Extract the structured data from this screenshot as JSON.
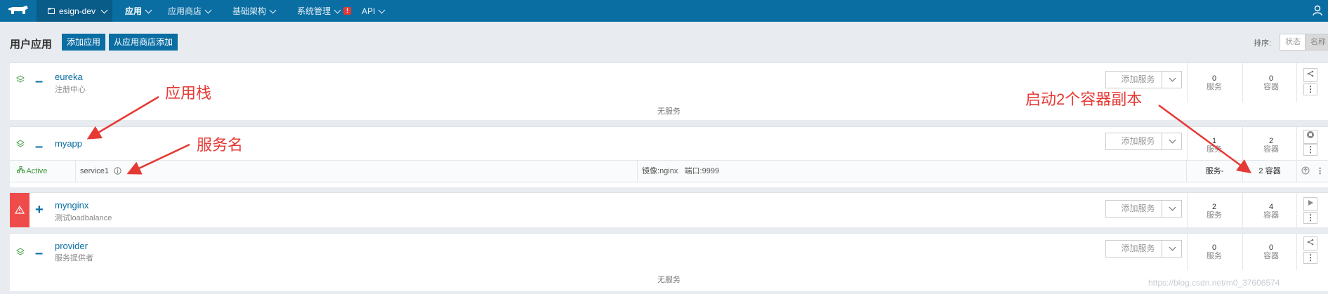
{
  "topbar": {
    "env_label": "esign-dev",
    "nav": [
      {
        "label": "应用",
        "active": true
      },
      {
        "label": "应用商店"
      },
      {
        "label": "基础架构"
      },
      {
        "label": "系统管理",
        "alert": "!"
      },
      {
        "label": "API"
      }
    ]
  },
  "toolbar": {
    "title": "用户应用",
    "add_app": "添加应用",
    "add_from_store": "从应用商店添加",
    "sort_label": "排序:",
    "sort_options": [
      "状态",
      "名称"
    ]
  },
  "stacks": [
    {
      "name": "eureka",
      "desc": "注册中心",
      "toggle": "–",
      "add_service": "添加服务",
      "services": "0",
      "services_unit": "服务",
      "containers": "0",
      "containers_unit": "容器",
      "empty_text": "无服务"
    },
    {
      "name": "myapp",
      "desc": "",
      "toggle": "–",
      "add_service": "添加服务",
      "services": "1",
      "services_unit": "服务",
      "containers": "2",
      "containers_unit": "容器",
      "service": {
        "state": "Active",
        "name": "service1",
        "image_label": "镜像:",
        "image": "nginx",
        "port_label": "端口:",
        "port": "9999",
        "services_col": "服务-",
        "containers_col": "2 容器"
      }
    },
    {
      "name": "mynginx",
      "desc": "测试loadbalance",
      "toggle": "+",
      "add_service": "添加服务",
      "services": "2",
      "services_unit": "服务",
      "containers": "4",
      "containers_unit": "容器"
    },
    {
      "name": "provider",
      "desc": "服务提供者",
      "toggle": "–",
      "add_service": "添加服务",
      "services": "0",
      "services_unit": "服务",
      "containers": "0",
      "containers_unit": "容器",
      "empty_text": "无服务"
    }
  ],
  "annotations": {
    "stack": "应用栈",
    "service_name": "服务名",
    "replicas": "启动2个容器副本"
  },
  "watermark": "https://blog.csdn.net/m0_37606574",
  "colors": {
    "topbar": "#0a6ea3",
    "accent": "#0a6ea3",
    "danger": "#f04b4b",
    "annotation": "#e53935",
    "active": "#3c9a3c"
  }
}
